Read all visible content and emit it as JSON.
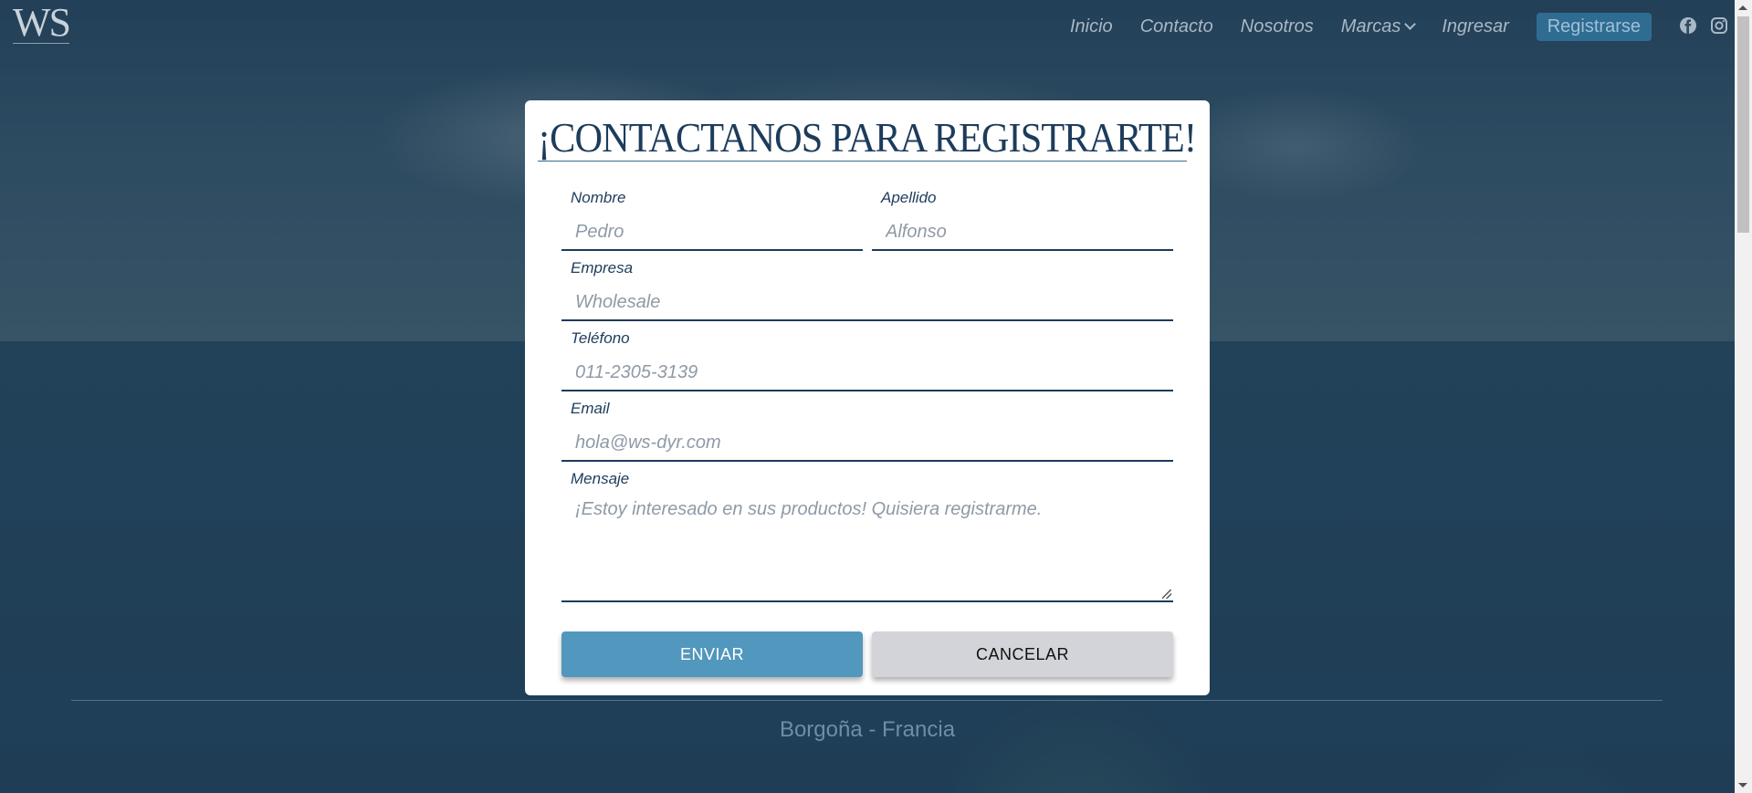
{
  "brand": {
    "logo_text": "WS"
  },
  "nav": {
    "items": [
      "Inicio",
      "Contacto",
      "Nosotros",
      "Marcas",
      "Ingresar"
    ],
    "register_label": "Registrarse",
    "social": [
      "facebook-icon",
      "instagram-icon"
    ]
  },
  "modal": {
    "title": "¡CONTACTANOS PARA REGISTRARTE!",
    "fields": {
      "nombre": {
        "label": "Nombre",
        "placeholder": "Pedro"
      },
      "apellido": {
        "label": "Apellido",
        "placeholder": "Alfonso"
      },
      "empresa": {
        "label": "Empresa",
        "placeholder": "Wholesale"
      },
      "telefono": {
        "label": "Teléfono",
        "placeholder": "011-2305-3139"
      },
      "email": {
        "label": "Email",
        "placeholder": "hola@ws-dyr.com"
      },
      "mensaje": {
        "label": "Mensaje",
        "placeholder": "¡Estoy interesado en sus productos! Quisiera registrarme."
      }
    },
    "send_label": "ENVIAR",
    "cancel_label": "CANCELAR"
  },
  "footer": {
    "location": "Borgoña - Francia"
  },
  "colors": {
    "primary": "#1d3c5c",
    "accent": "#5297bd",
    "cancel": "#d3d4d9"
  }
}
